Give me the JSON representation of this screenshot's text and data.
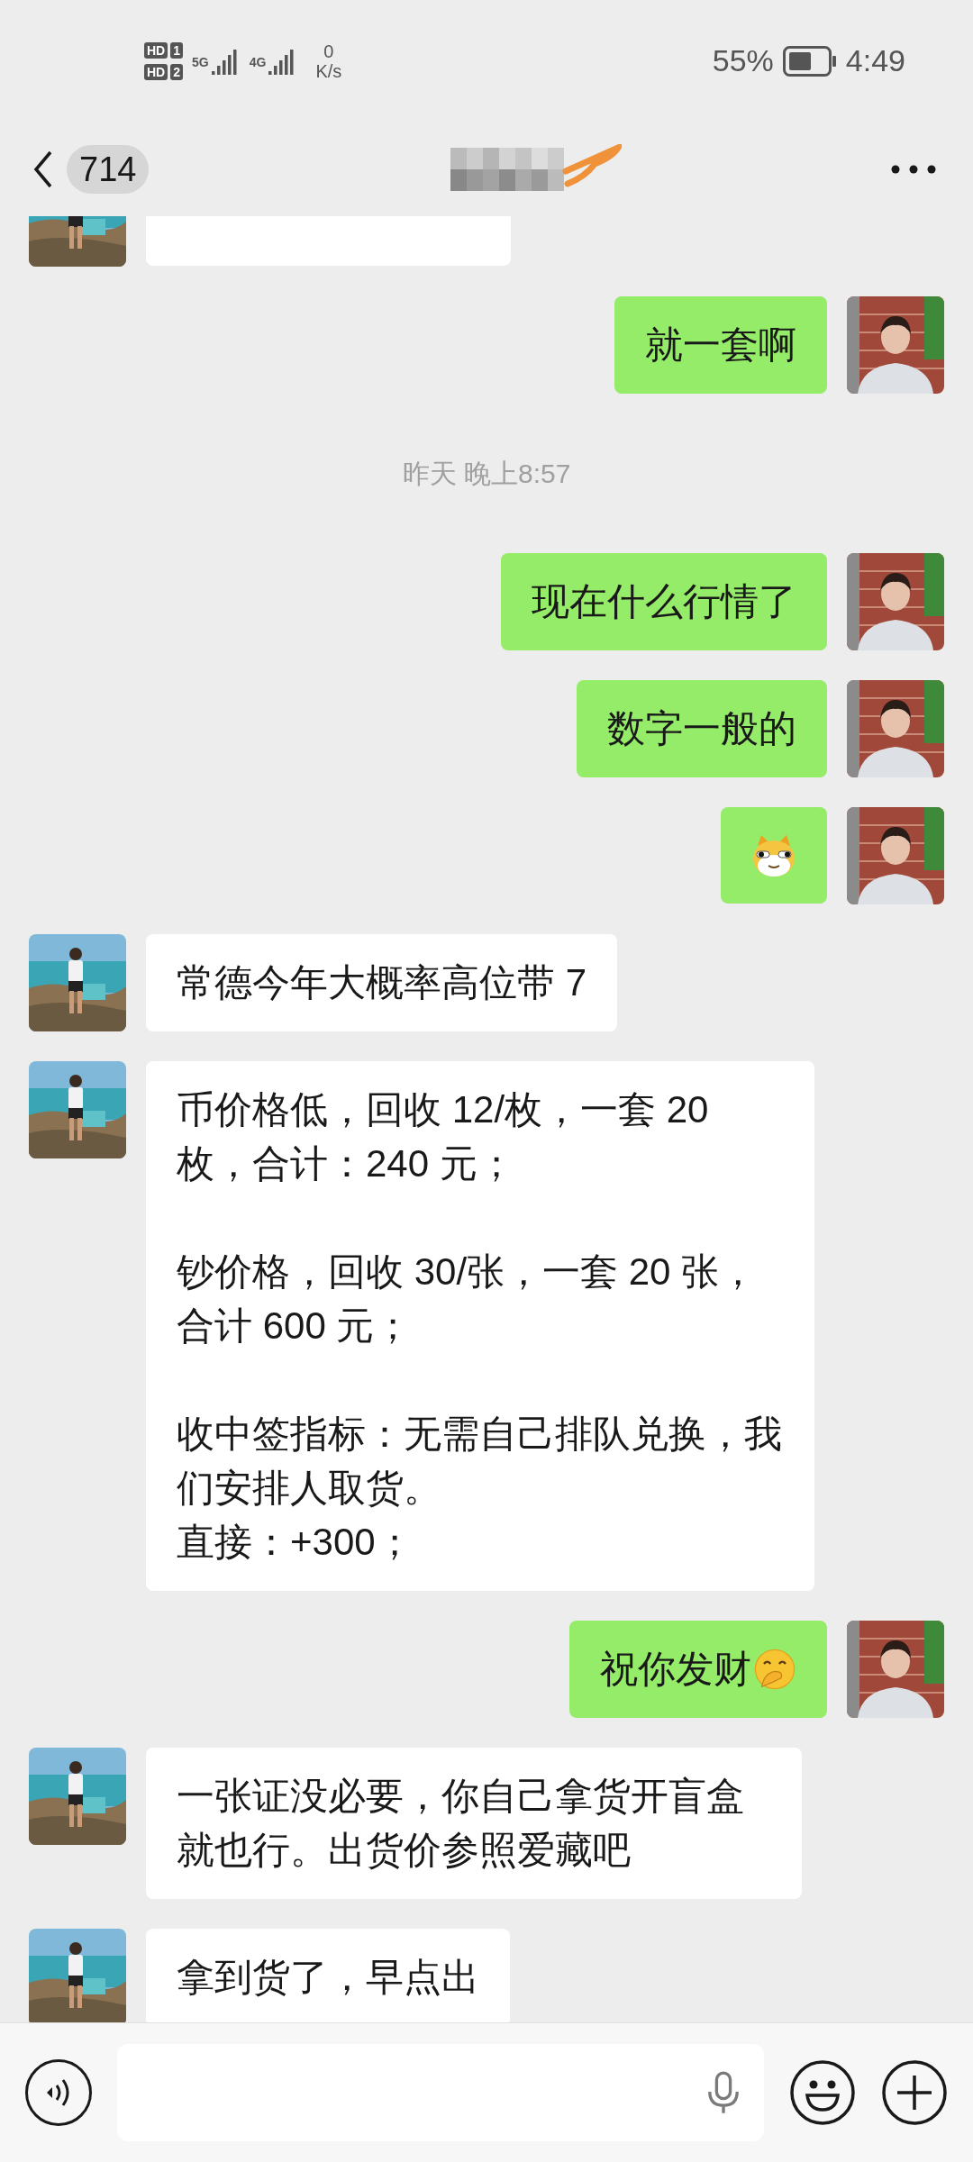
{
  "status_bar": {
    "sims": [
      {
        "badge": "HD",
        "slot": "1"
      },
      {
        "badge": "HD",
        "slot": "2"
      }
    ],
    "signals": [
      {
        "type": "5G"
      },
      {
        "type": "4G"
      }
    ],
    "speed": "0",
    "speed_unit": "K/s",
    "battery": "55%",
    "time": "4:49"
  },
  "header": {
    "unread_count": "714"
  },
  "messages": [
    {
      "kind": "cut_off",
      "outgoing": false
    },
    {
      "kind": "text",
      "outgoing": true,
      "text": "就一套啊"
    },
    {
      "kind": "time",
      "text": "昨天 晚上8:57"
    },
    {
      "kind": "text",
      "outgoing": true,
      "text": "现在什么行情了"
    },
    {
      "kind": "text",
      "outgoing": true,
      "text": "数字一般的"
    },
    {
      "kind": "sticker",
      "outgoing": true
    },
    {
      "kind": "text",
      "outgoing": false,
      "text": "常德今年大概率高位带 7"
    },
    {
      "kind": "paragraphs",
      "outgoing": false,
      "paragraphs": [
        [
          "币价格低，回收 12/枚，一套 20 枚，合计：240 元；"
        ],
        [
          "钞价格，回收 30/张，一套 20 张，合计 600 元；"
        ],
        [
          "收中签指标：无需自己排队兑换，我们安排人取货。",
          "直接：+300；"
        ]
      ]
    },
    {
      "kind": "text_emoji",
      "outgoing": true,
      "text": "祝你发财"
    },
    {
      "kind": "text",
      "outgoing": false,
      "text": "一张证没必要，你自己拿货开盲盒就也行。出货价参照爱藏吧"
    },
    {
      "kind": "text",
      "outgoing": false,
      "text": "拿到货了，早点出"
    }
  ]
}
